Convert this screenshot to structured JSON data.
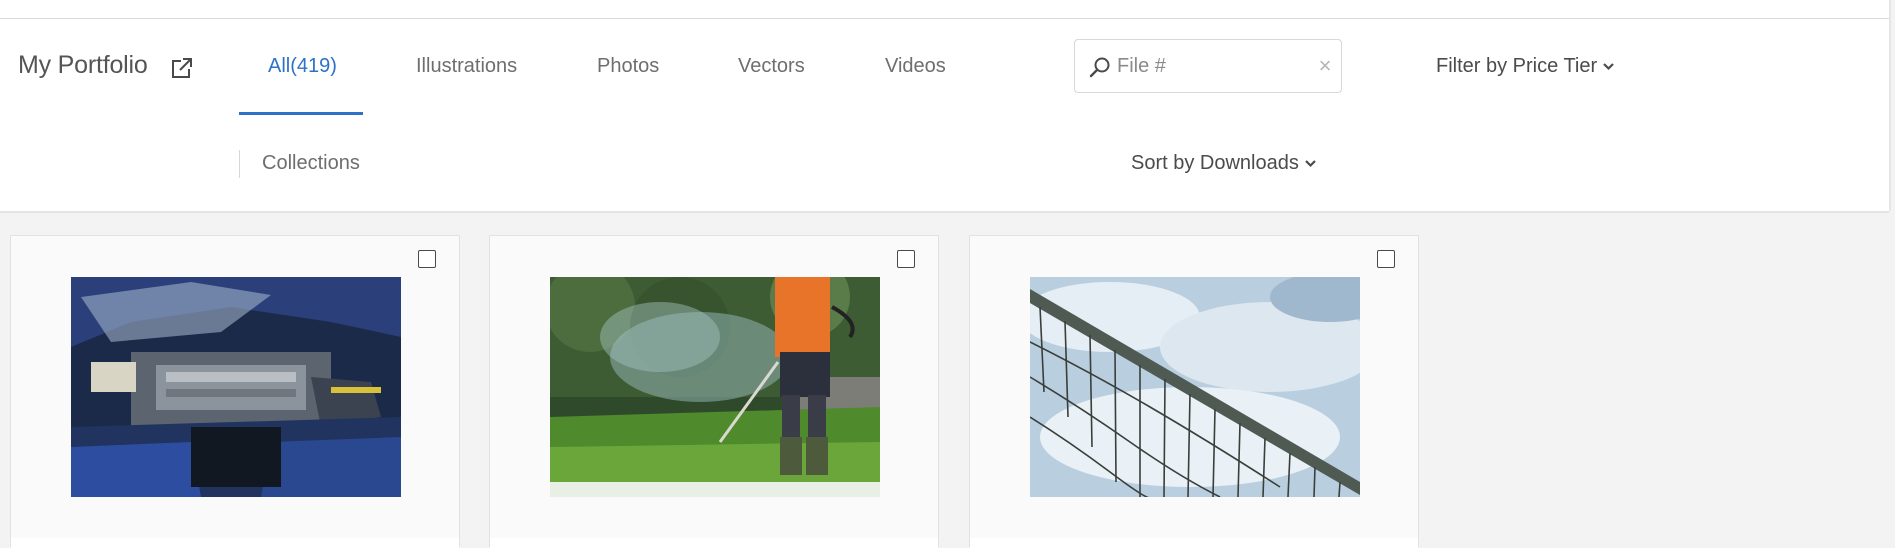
{
  "header": {
    "title": "My Portfolio",
    "external_icon": "external-link-icon"
  },
  "tabs": [
    {
      "label": "All(419)",
      "active": true
    },
    {
      "label": "Illustrations",
      "active": false
    },
    {
      "label": "Photos",
      "active": false
    },
    {
      "label": "Vectors",
      "active": false
    },
    {
      "label": "Videos",
      "active": false
    }
  ],
  "search": {
    "placeholder": "File #",
    "value": "",
    "icon": "search-icon",
    "clear_icon": "close-icon",
    "clear_glyph": "×"
  },
  "filters": {
    "price_tier_label": "Filter by Price Tier",
    "sort_label": "Sort by Downloads"
  },
  "collections": {
    "label": "Collections"
  },
  "colors": {
    "accent": "#2d72c8",
    "text": "#4b4b4b",
    "muted_text": "#6e6e6e",
    "background": "#f3f3f3"
  },
  "assets": [
    {
      "image": "car-engine-photo",
      "checked": false
    },
    {
      "image": "grass-trimmer-worker-photo",
      "checked": false
    },
    {
      "image": "volleyball-net-sky-photo",
      "checked": false
    }
  ]
}
